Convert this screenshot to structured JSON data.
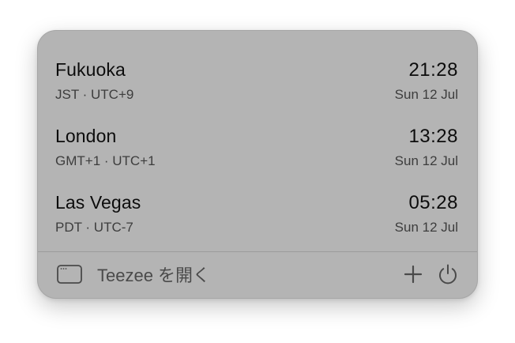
{
  "clocks": [
    {
      "city": "Fukuoka",
      "zone": "JST · UTC+9",
      "time": "21:28",
      "date": "Sun 12 Jul"
    },
    {
      "city": "London",
      "zone": "GMT+1 · UTC+1",
      "time": "13:28",
      "date": "Sun 12 Jul"
    },
    {
      "city": "Las Vegas",
      "zone": "PDT · UTC-7",
      "time": "05:28",
      "date": "Sun 12 Jul"
    }
  ],
  "footer": {
    "open_label": "Teezee を開く",
    "open_icon": "window-icon",
    "add_icon": "plus-icon",
    "quit_icon": "power-icon"
  }
}
